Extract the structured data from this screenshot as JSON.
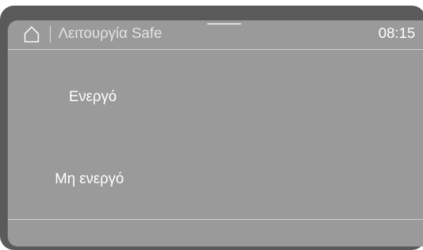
{
  "header": {
    "home_icon": "home-icon",
    "title": "Λειτουργία Safe",
    "time": "08:15"
  },
  "options": [
    {
      "label": "Ενεργό"
    },
    {
      "label": "Μη ενεργό"
    }
  ],
  "colors": {
    "bezel": "#5a5a5a",
    "screen": "#9a9a9a",
    "text": "#ffffff"
  }
}
